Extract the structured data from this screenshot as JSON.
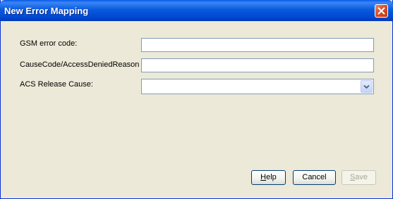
{
  "window": {
    "title": "New Error Mapping"
  },
  "form": {
    "gsm_error_code": {
      "label": "GSM error code:",
      "value": ""
    },
    "cause_code": {
      "label": "CauseCode/AccessDeniedReason",
      "value": ""
    },
    "acs_release_cause": {
      "label": "ACS Release Cause:",
      "value": ""
    }
  },
  "buttons": {
    "help": {
      "label_pre": "",
      "label_mnemonic": "H",
      "label_post": "elp"
    },
    "cancel": {
      "label": "Cancel"
    },
    "save": {
      "label_pre": "",
      "label_mnemonic": "S",
      "label_post": "ave",
      "enabled": false
    }
  },
  "colors": {
    "title_bar": "#0a5bdc",
    "dialog_background": "#ece9d8",
    "input_border": "#7f9db9",
    "close_button": "#d8502a"
  },
  "icons": {
    "close": "close-icon",
    "dropdown": "chevron-down-icon"
  }
}
